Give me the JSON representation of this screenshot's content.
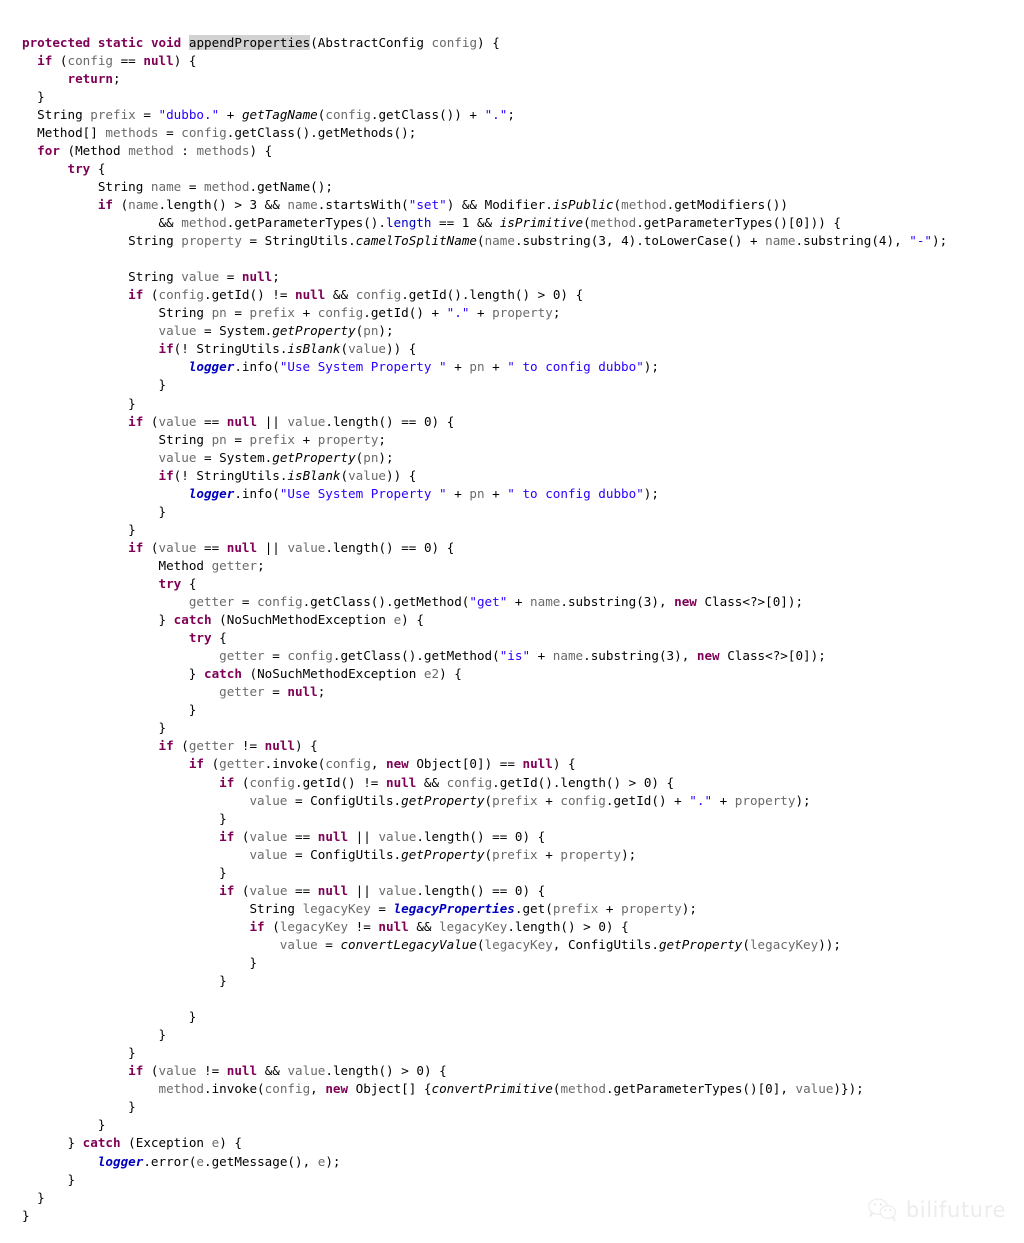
{
  "document": {
    "kind": "source-code-listing",
    "language": "Java",
    "method_name": "appendProperties",
    "highlighted_token": "appendProperties"
  },
  "colors": {
    "background": "#ffffff",
    "plain_text": "#000000",
    "keyword": "#7f0055",
    "string": "#2a00ff",
    "field": "#0000c0",
    "static_field": "#0000c0",
    "local_variable": "#6a6a6a",
    "selection_highlight": "#d2d2d2",
    "watermark": "#ececed"
  },
  "watermark": {
    "icon": "wechat-icon",
    "label": "bilifuture"
  },
  "code": {
    "lines": [
      "protected static void appendProperties(AbstractConfig config) {",
      "    if (config == null) {",
      "        return;",
      "    }",
      "    String prefix = \"dubbo.\" + getTagName(config.getClass()) + \".\";",
      "    Method[] methods = config.getClass().getMethods();",
      "    for (Method method : methods) {",
      "        try {",
      "            String name = method.getName();",
      "            if (name.length() > 3 && name.startsWith(\"set\") && Modifier.isPublic(method.getModifiers())",
      "                    && method.getParameterTypes().length == 1 && isPrimitive(method.getParameterTypes()[0])) {",
      "                String property = StringUtils.camelToSplitName(name.substring(3, 4).toLowerCase() + name.substring(4), \"-\");",
      "",
      "                String value = null;",
      "                if (config.getId() != null && config.getId().length() > 0) {",
      "                    String pn = prefix + config.getId() + \".\" + property;",
      "                    value = System.getProperty(pn);",
      "                    if(! StringUtils.isBlank(value)) {",
      "                        logger.info(\"Use System Property \" + pn + \" to config dubbo\");",
      "                    }",
      "                }",
      "                if (value == null || value.length() == 0) {",
      "                    String pn = prefix + property;",
      "                    value = System.getProperty(pn);",
      "                    if(! StringUtils.isBlank(value)) {",
      "                        logger.info(\"Use System Property \" + pn + \" to config dubbo\");",
      "                    }",
      "                }",
      "                if (value == null || value.length() == 0) {",
      "                    Method getter;",
      "                    try {",
      "                        getter = config.getClass().getMethod(\"get\" + name.substring(3), new Class<?>[0]);",
      "                    } catch (NoSuchMethodException e) {",
      "                        try {",
      "                            getter = config.getClass().getMethod(\"is\" + name.substring(3), new Class<?>[0]);",
      "                        } catch (NoSuchMethodException e2) {",
      "                            getter = null;",
      "                        }",
      "                    }",
      "                    if (getter != null) {",
      "                        if (getter.invoke(config, new Object[0]) == null) {",
      "                            if (config.getId() != null && config.getId().length() > 0) {",
      "                                value = ConfigUtils.getProperty(prefix + config.getId() + \".\" + property);",
      "                            }",
      "                            if (value == null || value.length() == 0) {",
      "                                value = ConfigUtils.getProperty(prefix + property);",
      "                            }",
      "                            if (value == null || value.length() == 0) {",
      "                                String legacyKey = legacyProperties.get(prefix + property);",
      "                                if (legacyKey != null && legacyKey.length() > 0) {",
      "                                    value = convertLegacyValue(legacyKey, ConfigUtils.getProperty(legacyKey));",
      "                                }",
      "                            }",
      "",
      "                        }",
      "                    }",
      "                }",
      "                if (value != null && value.length() > 0) {",
      "                    method.invoke(config, new Object[] {convertPrimitive(method.getParameterTypes()[0], value)});",
      "                }",
      "            }",
      "        } catch (Exception e) {",
      "            logger.error(e.getMessage(), e);",
      "        }",
      "    }",
      "}"
    ],
    "tokens": {
      "keywords": [
        "protected",
        "static",
        "void",
        "if",
        "return",
        "for",
        "try",
        "catch",
        "new",
        "null"
      ],
      "types": [
        "AbstractConfig",
        "String",
        "Method",
        "Modifier",
        "StringUtils",
        "Class",
        "Object",
        "System",
        "ConfigUtils",
        "NoSuchMethodException",
        "Exception"
      ],
      "static_fields": [
        "logger",
        "legacyProperties"
      ],
      "static_methods": [
        "getTagName",
        "isPublic",
        "isPrimitive",
        "camelToSplitName",
        "getProperty",
        "isBlank",
        "convertLegacyValue",
        "convertPrimitive"
      ],
      "string_literals": [
        "\"dubbo.\"",
        "\".\"",
        "\"set\"",
        "\"-\"",
        "\"Use System Property \"",
        "\" to config dubbo\"",
        "\"get\"",
        "\"is\""
      ],
      "numeric_literals": [
        "3",
        "4",
        "1",
        "0"
      ]
    }
  }
}
